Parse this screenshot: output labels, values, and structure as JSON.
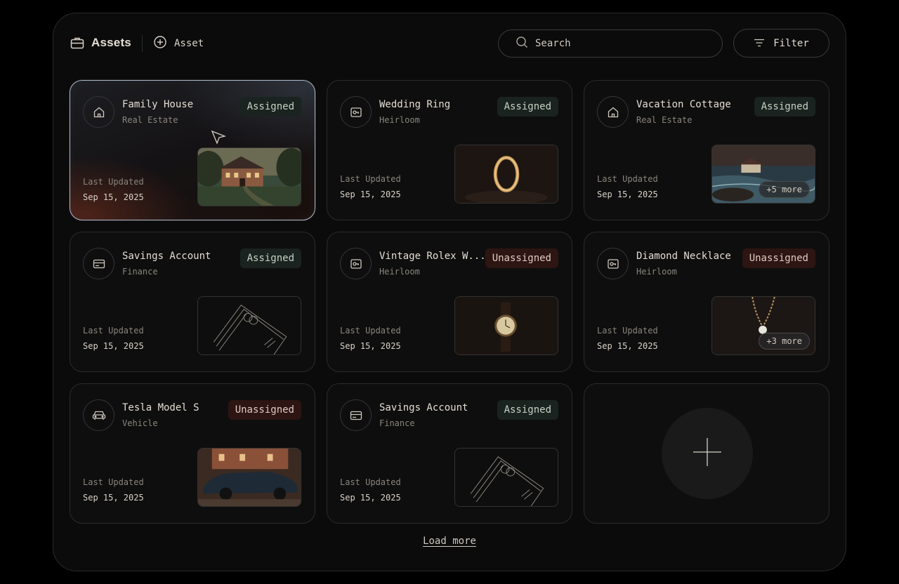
{
  "header": {
    "title": "Assets",
    "add_label": "Asset",
    "search_placeholder": "Search",
    "filter_label": "Filter"
  },
  "cards": [
    {
      "name": "Family House",
      "category": "Real Estate",
      "status": "Assigned",
      "updated_label": "Last Updated",
      "updated_date": "Sep 15, 2025",
      "icon": "house-icon",
      "thumb": "house-photo",
      "more": ""
    },
    {
      "name": "Wedding Ring",
      "category": "Heirloom",
      "status": "Assigned",
      "updated_label": "Last Updated",
      "updated_date": "Sep 15, 2025",
      "icon": "heirloom-icon",
      "thumb": "ring-photo",
      "more": ""
    },
    {
      "name": "Vacation Cottage",
      "category": "Real Estate",
      "status": "Assigned",
      "updated_label": "Last Updated",
      "updated_date": "Sep 15, 2025",
      "icon": "house-icon",
      "thumb": "cottage-photo",
      "more": "+5 more"
    },
    {
      "name": "Savings Account",
      "category": "Finance",
      "status": "Assigned",
      "updated_label": "Last Updated",
      "updated_date": "Sep 15, 2025",
      "icon": "card-icon",
      "thumb": "card-sketch",
      "more": ""
    },
    {
      "name": "Vintage Rolex W...",
      "category": "Heirloom",
      "status": "Unassigned",
      "updated_label": "Last Updated",
      "updated_date": "Sep 15, 2025",
      "icon": "heirloom-icon",
      "thumb": "watch-photo",
      "more": ""
    },
    {
      "name": "Diamond Necklace",
      "category": "Heirloom",
      "status": "Unassigned",
      "updated_label": "Last Updated",
      "updated_date": "Sep 15, 2025",
      "icon": "heirloom-icon",
      "thumb": "necklace-photo",
      "more": "+3 more"
    },
    {
      "name": "Tesla Model S",
      "category": "Vehicle",
      "status": "Unassigned",
      "updated_label": "Last Updated",
      "updated_date": "Sep 15, 2025",
      "icon": "car-icon",
      "thumb": "car-photo",
      "more": ""
    },
    {
      "name": "Savings Account",
      "category": "Finance",
      "status": "Assigned",
      "updated_label": "Last Updated",
      "updated_date": "Sep 15, 2025",
      "icon": "card-icon",
      "thumb": "card-sketch",
      "more": ""
    }
  ],
  "load_more_label": "Load more",
  "colors": {
    "background": "#000000",
    "panel": "#0b0b0b",
    "assigned_badge": "#1a231f",
    "unassigned_badge": "#2c1512",
    "active_border": "#a9b6c9"
  }
}
